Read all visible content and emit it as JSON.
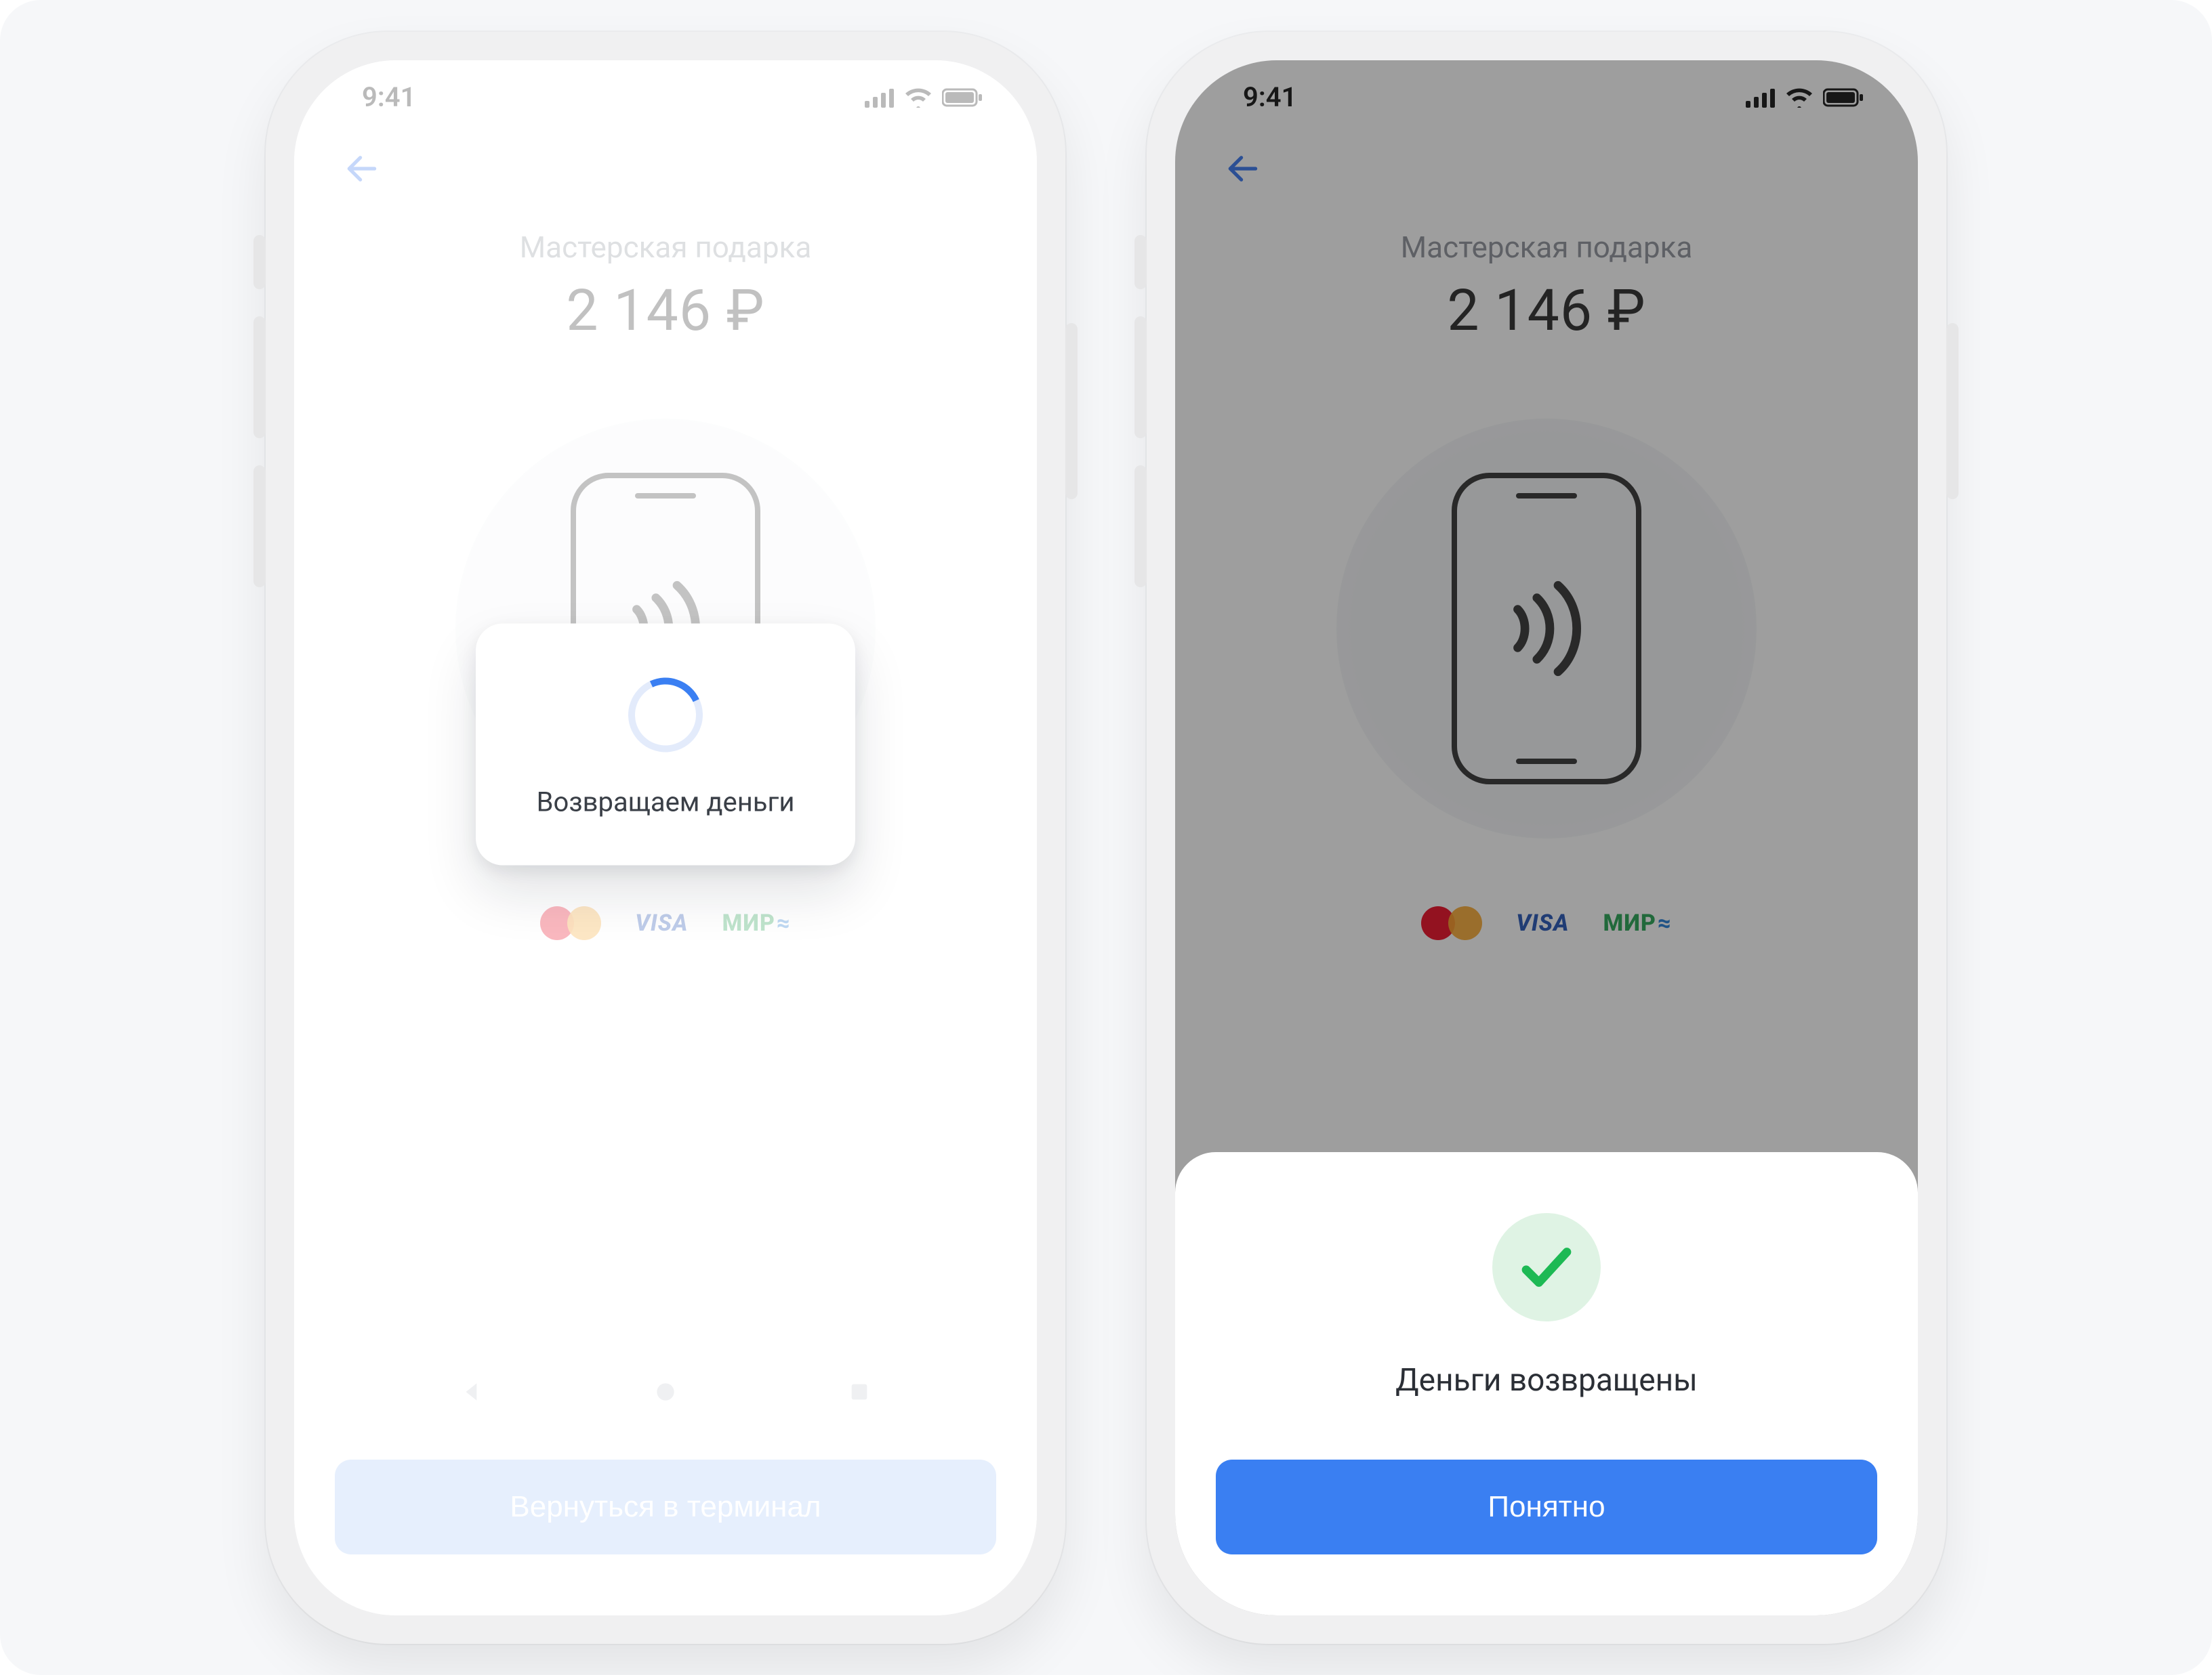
{
  "status": {
    "time": "9:41"
  },
  "merchant": {
    "name": "Мастерская подарка",
    "amount": "2 146 ₽"
  },
  "brands": {
    "visa": "VISA",
    "mir": "МИР"
  },
  "screen1": {
    "loading_text": "Возвращаем деньги",
    "button": "Вернуться в терминал"
  },
  "screen2": {
    "sheet_text": "Деньги возвращены",
    "button": "Понятно"
  }
}
